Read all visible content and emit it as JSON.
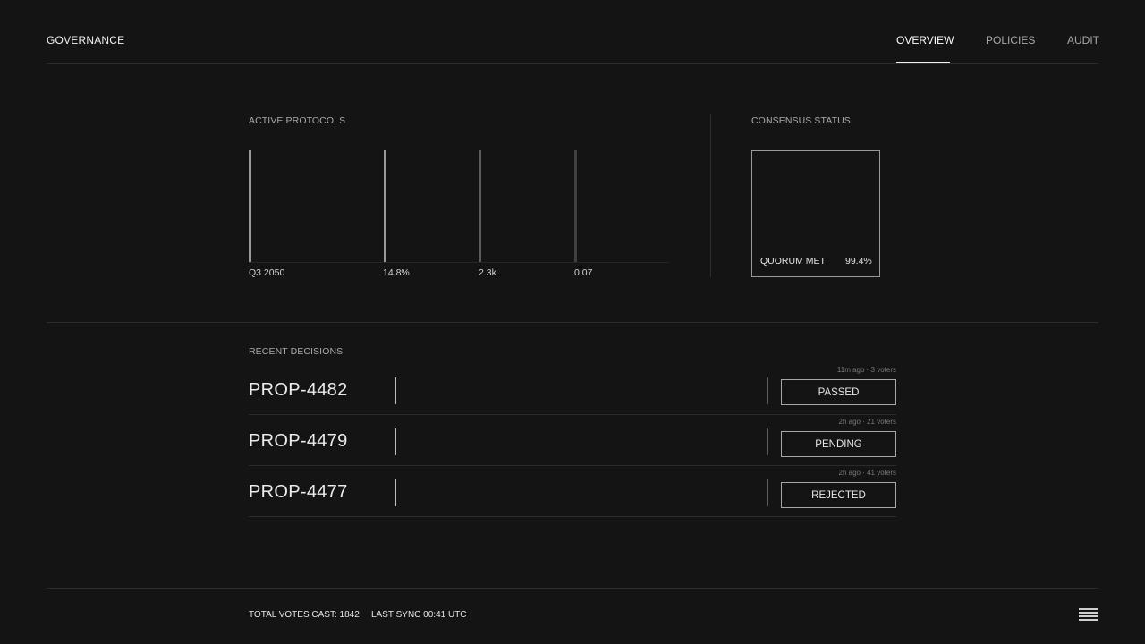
{
  "header": {
    "brand": "GOVERNANCE",
    "nav": [
      "OVERVIEW",
      "POLICIES",
      "AUDIT"
    ],
    "active_nav": "OVERVIEW"
  },
  "protocols": {
    "label": "ACTIVE PROTOCOLS",
    "items": [
      {
        "value": "Q3 2050",
        "color": "#9a9a9a"
      },
      {
        "value": "14.8%",
        "color": "#9a9a9a"
      },
      {
        "value": "2.3k",
        "color": "#5c5c5c"
      },
      {
        "value": "0.07",
        "color": "#404040"
      }
    ]
  },
  "consensus": {
    "label": "CONSENSUS STATUS",
    "status": "QUORUM MET",
    "value": "99.4%"
  },
  "decisions": {
    "label": "RECENT DECISIONS",
    "rows": [
      {
        "id": "PROP-4482",
        "meta": "11m ago · 3 voters",
        "status": "PASSED"
      },
      {
        "id": "PROP-4479",
        "meta": "2h ago · 21 voters",
        "status": "PENDING"
      },
      {
        "id": "PROP-4477",
        "meta": "2h ago · 41 voters",
        "status": "REJECTED"
      }
    ]
  },
  "footer": {
    "total_votes": "TOTAL VOTES CAST: 1842",
    "last_sync": "LAST SYNC 00:41 UTC"
  },
  "icons": {
    "menu": "menu-icon"
  }
}
